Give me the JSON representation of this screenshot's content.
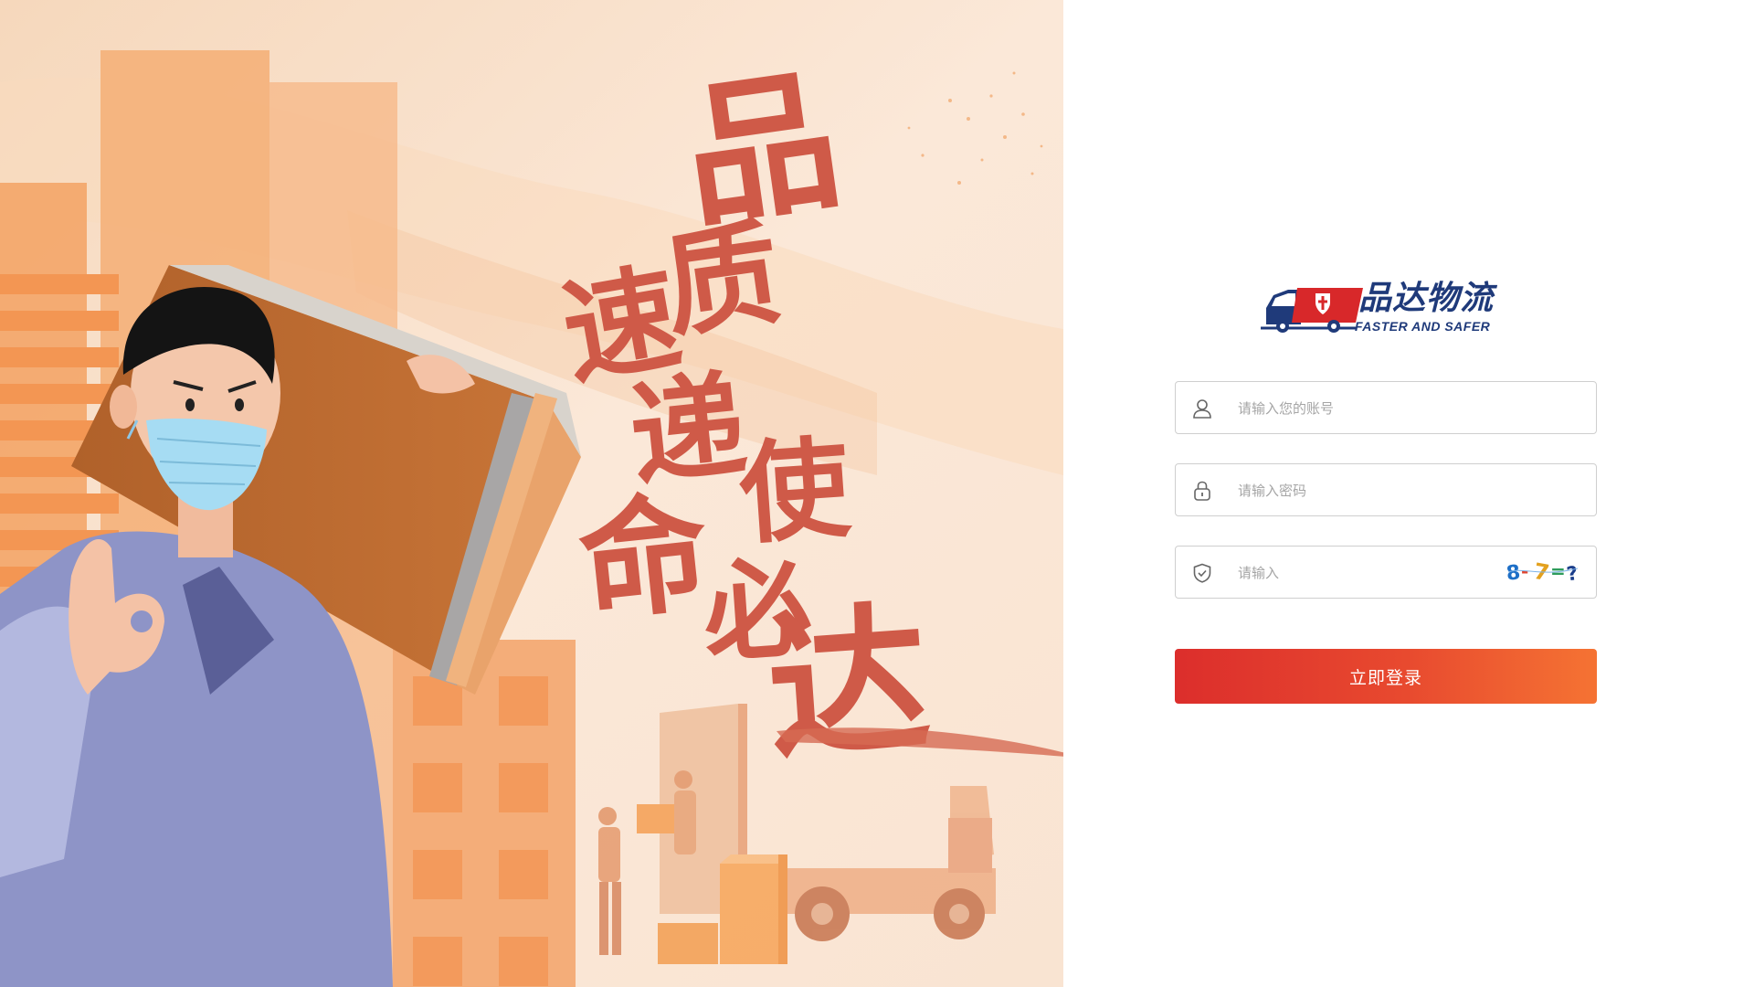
{
  "hero": {
    "slogan_lines": [
      "品",
      "质速递",
      "使命必达"
    ],
    "chars": [
      "品",
      "质",
      "速",
      "递",
      "使",
      "命",
      "必",
      "达"
    ]
  },
  "logo": {
    "name_cn": "品达物流",
    "tagline_en": "FASTER AND SAFER",
    "truck_icon": "truck-shield-icon"
  },
  "form": {
    "account": {
      "placeholder": "请输入您的账号",
      "value": "",
      "icon": "user-icon"
    },
    "password": {
      "placeholder": "请输入密码",
      "value": "",
      "icon": "lock-icon"
    },
    "captcha": {
      "placeholder": "请输入",
      "value": "",
      "icon": "shield-check-icon",
      "image_text": "8-7=?"
    },
    "submit_label": "立即登录"
  },
  "colors": {
    "accent_start": "#dc2e2c",
    "accent_end": "#f57333",
    "brand_blue": "#1f3a7a",
    "brand_red": "#d8282a",
    "calligraphy": "#cf5a48",
    "hero_bg": "#fbe9d9"
  }
}
